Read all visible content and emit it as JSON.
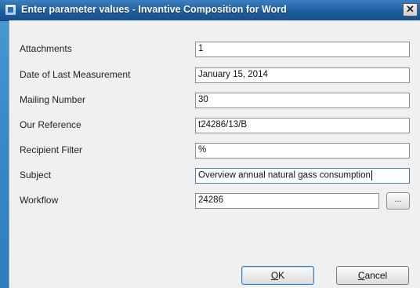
{
  "window": {
    "title": "Enter parameter values - Invantive Composition for Word",
    "close_glyph": "✕"
  },
  "params": [
    {
      "label": "Attachments",
      "value": "1"
    },
    {
      "label": "Date of Last Measurement",
      "value": "January 15, 2014"
    },
    {
      "label": "Mailing Number",
      "value": "30"
    },
    {
      "label": "Our Reference",
      "value": "t24286/13/B"
    },
    {
      "label": "Recipient Filter",
      "value": "%"
    },
    {
      "label": "Subject",
      "value": "Overview annual natural gass consumption"
    },
    {
      "label": "Workflow",
      "value": "24286"
    }
  ],
  "workflow_browse_label": "...",
  "buttons": {
    "ok_accel": "O",
    "ok_rest": "K",
    "cancel_accel": "C",
    "cancel_rest": "ancel"
  }
}
